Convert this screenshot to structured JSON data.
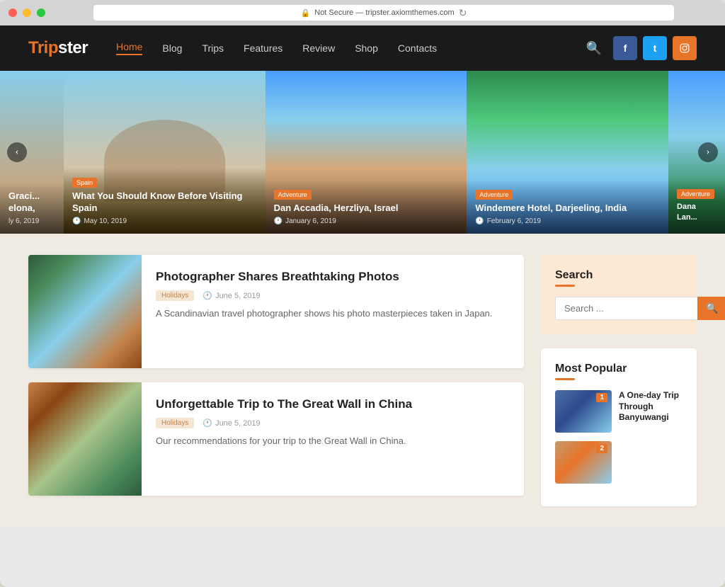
{
  "browser": {
    "url": "Not Secure — tripster.axiomthemes.com",
    "dots": [
      "red",
      "yellow",
      "green"
    ]
  },
  "site": {
    "logo": {
      "trip": "Trip",
      "ster": "ster"
    },
    "nav": {
      "links": [
        {
          "label": "Home",
          "active": true
        },
        {
          "label": "Blog",
          "active": false
        },
        {
          "label": "Trips",
          "active": false
        },
        {
          "label": "Features",
          "active": false
        },
        {
          "label": "Review",
          "active": false
        },
        {
          "label": "Shop",
          "active": false
        },
        {
          "label": "Contacts",
          "active": false
        }
      ],
      "social": [
        {
          "id": "fb",
          "label": "f"
        },
        {
          "id": "tw",
          "label": "t"
        },
        {
          "id": "ig",
          "label": "ig"
        }
      ]
    },
    "slider": {
      "prev_arrow": "‹",
      "next_arrow": "›",
      "cards": [
        {
          "id": "partial-left",
          "partial": true,
          "title": "Graci... elona,",
          "date": "ly 6, 2019",
          "tag": null,
          "bg": "partial-left-bg"
        },
        {
          "id": "spain",
          "title": "What You Should Know Before Visiting Spain",
          "tag": "Spain",
          "date": "May 10, 2019",
          "bg": "bg-spain"
        },
        {
          "id": "israel",
          "title": "Dan Accadia, Herzliya, Israel",
          "tag": "Adventure",
          "date": "January 6, 2019",
          "bg": "bg-israel"
        },
        {
          "id": "india",
          "title": "Windemere Hotel, Darjeeling, India",
          "tag": "Adventure",
          "date": "February 6, 2019",
          "bg": "bg-india"
        },
        {
          "id": "malaysia",
          "title": "Dana Lan... Hotel, Lar... Malaysia",
          "tag": "Adventure",
          "date": "",
          "bg": "bg-malaysia",
          "partial": true
        }
      ]
    },
    "articles": [
      {
        "id": "article-1",
        "title": "Photographer Shares Breathtaking Photos",
        "tag": "Holidays",
        "date": "June 5, 2019",
        "excerpt": "A Scandinavian travel photographer shows his photo masterpieces taken in Japan.",
        "bg": "bg-photo1"
      },
      {
        "id": "article-2",
        "title": "Unforgettable Trip to The Great Wall in China",
        "tag": "Holidays",
        "date": "June 5, 2019",
        "excerpt": "Our recommendations for your trip to the Great Wall in China.",
        "bg": "bg-photo2"
      }
    ],
    "sidebar": {
      "search_widget": {
        "title": "Search",
        "title_line": true,
        "input_placeholder": "Search ...",
        "button_icon": "🔍"
      },
      "popular_widget": {
        "title": "Most Popular",
        "title_line": true,
        "items": [
          {
            "num": "1",
            "title": "A One-day Trip Through Banyuwangi",
            "bg": "bg-popular1"
          },
          {
            "num": "2",
            "title": "",
            "bg": "bg-popular2"
          }
        ]
      }
    }
  }
}
